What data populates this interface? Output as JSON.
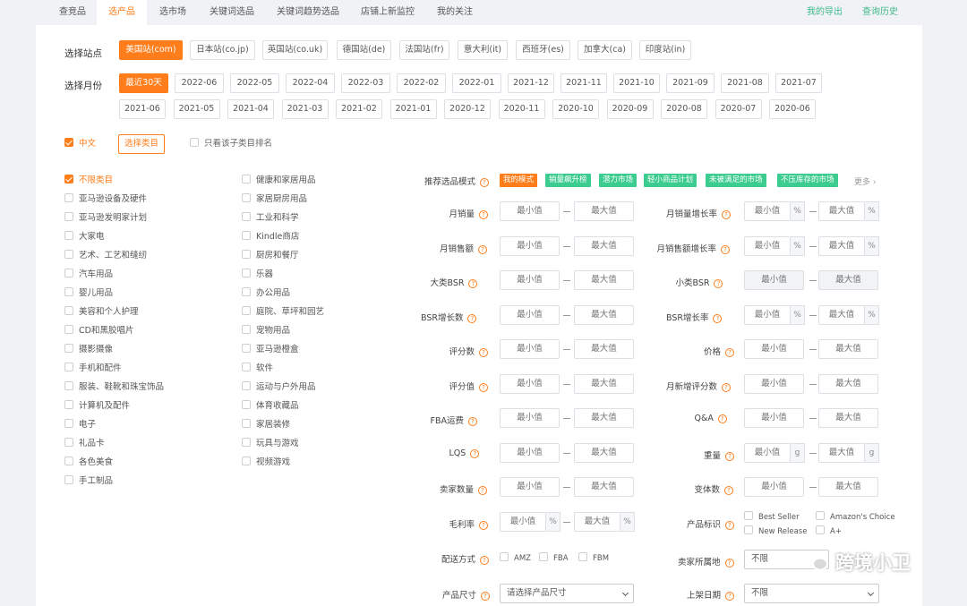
{
  "nav": {
    "left": [
      "查竞品",
      "选产品",
      "选市场",
      "关键词选品",
      "关键词趋势选品",
      "店铺上新监控",
      "我的关注"
    ],
    "active_index": 1,
    "right": [
      "我的导出",
      "查询历史"
    ]
  },
  "site": {
    "label": "选择站点",
    "options": [
      "美国站(com)",
      "日本站(co.jp)",
      "英国站(co.uk)",
      "德国站(de)",
      "法国站(fr)",
      "意大利(it)",
      "西班牙(es)",
      "加拿大(ca)",
      "印度站(in)"
    ],
    "selected_index": 0
  },
  "month": {
    "label": "选择月份",
    "row1": [
      "最近30天",
      "2022-06",
      "2022-05",
      "2022-04",
      "2022-03",
      "2022-02",
      "2022-01",
      "2021-12",
      "2021-11",
      "2021-10",
      "2021-09",
      "2021-08",
      "2021-07"
    ],
    "row2": [
      "2021-06",
      "2021-05",
      "2021-04",
      "2021-03",
      "2021-02",
      "2021-01",
      "2020-12",
      "2020-11",
      "2020-10",
      "2020-09",
      "2020-08",
      "2020-07",
      "2020-06"
    ],
    "selected": "最近30天"
  },
  "options_row": {
    "chinese": "中文",
    "select_category": "选择类目",
    "only_sub_rank": "只看该子类目排名"
  },
  "categories": {
    "col1": [
      "不限类目",
      "亚马逊设备及硬件",
      "亚马逊发明家计划",
      "大家电",
      "艺术、工艺和缝纫",
      "汽车用品",
      "婴儿用品",
      "美容和个人护理",
      "CD和黑胶唱片",
      "摄影摄像",
      "手机和配件",
      "服装、鞋靴和珠宝饰品",
      "计算机及配件",
      "电子",
      "礼品卡",
      "各色美食",
      "手工制品"
    ],
    "col2": [
      "健康和家居用品",
      "家居厨房用品",
      "工业和科学",
      "Kindle商店",
      "厨房和餐厅",
      "乐器",
      "办公用品",
      "庭院、草坪和园艺",
      "宠物用品",
      "亚马逊橙盒",
      "软件",
      "运动与户外用品",
      "体育收藏品",
      "家居装修",
      "玩具与游戏",
      "视频游戏"
    ]
  },
  "mode": {
    "label": "推荐选品模式",
    "tags": [
      "我的模式",
      "销量飙升榜",
      "潜力市场",
      "轻小商品计划",
      "未被满足的市场",
      "不压库存的市场"
    ],
    "more": "更多"
  },
  "placeholders": {
    "min": "最小值",
    "max": "最大值"
  },
  "units": {
    "percent": "%",
    "gram": "g"
  },
  "filters_left": {
    "monthly_sales": "月销量",
    "monthly_revenue": "月销售额",
    "main_bsr": "大类BSR",
    "bsr_growth_count": "BSR增长数",
    "review_count": "评分数",
    "rating": "评分值",
    "fba_fee": "FBA运费",
    "lqs": "LQS",
    "seller_count": "卖家数量",
    "gross_margin": "毛利率",
    "shipping": "配送方式",
    "size": "产品尺寸"
  },
  "filters_right": {
    "sales_growth": "月销量增长率",
    "revenue_growth": "月销售额增长率",
    "sub_bsr": "小类BSR",
    "bsr_growth_rate": "BSR增长率",
    "price": "价格",
    "new_reviews": "月新增评分数",
    "qa": "Q&A",
    "weight": "重量",
    "variants": "变体数",
    "product_badge": "产品标识",
    "seller_location": "卖家所属地",
    "listing_date": "上架日期"
  },
  "shipping_options": [
    "AMZ",
    "FBA",
    "FBM"
  ],
  "badges": [
    "Best Seller",
    "Amazon's Choice",
    "New Release",
    "A+"
  ],
  "selects": {
    "size_placeholder": "请选择产品尺寸",
    "seller_location_value": "不限",
    "listing_date_value": "不限"
  },
  "watermark": "跨境小卫",
  "colors": {
    "accent": "#ff7d1a",
    "green": "#3ccc8f",
    "link_green": "#3fb98c"
  }
}
